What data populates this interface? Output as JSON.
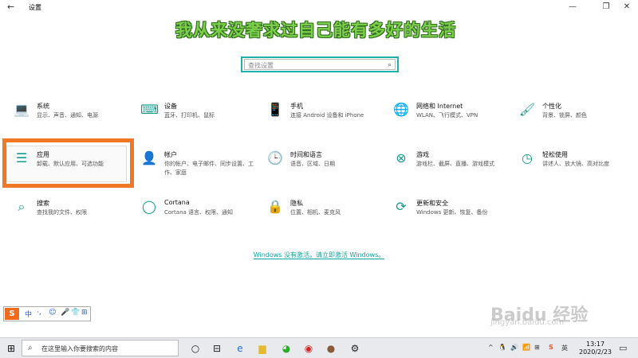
{
  "window": {
    "back_icon": "←",
    "title": "设置",
    "min_icon": "—",
    "max_icon": "❐",
    "close_icon": "✕"
  },
  "overlay_text": "我从来没奢求过自己能有多好的生活",
  "search": {
    "placeholder": "查找设置",
    "icon": "⌕"
  },
  "tiles": [
    {
      "key": "system",
      "icon": "💻",
      "name": "系统",
      "desc": "显示、声音、通知、电源"
    },
    {
      "key": "devices",
      "icon": "⌨",
      "name": "设备",
      "desc": "蓝牙、打印机、鼠标"
    },
    {
      "key": "phone",
      "icon": "📱",
      "name": "手机",
      "desc": "连接 Android 设备和 iPhone"
    },
    {
      "key": "network",
      "icon": "🌐",
      "name": "网络和 Internet",
      "desc": "WLAN、飞行模式、VPN"
    },
    {
      "key": "personalization",
      "icon": "🖌",
      "name": "个性化",
      "desc": "背景、锁屏、颜色"
    },
    {
      "key": "apps",
      "icon": "☰",
      "name": "应用",
      "desc": "卸载、默认应用、可选功能"
    },
    {
      "key": "accounts",
      "icon": "👤",
      "name": "帐户",
      "desc": "你的帐户、电子邮件、同步设置、工作、家庭"
    },
    {
      "key": "time-language",
      "icon": "🕒",
      "name": "时间和语言",
      "desc": "语音、区域、日期"
    },
    {
      "key": "gaming",
      "icon": "⊗",
      "name": "游戏",
      "desc": "游戏栏、截屏、直播、游戏模式"
    },
    {
      "key": "ease-of-access",
      "icon": "◷",
      "name": "轻松使用",
      "desc": "讲述人、放大镜、高对比度"
    },
    {
      "key": "search",
      "icon": "⌕",
      "name": "搜索",
      "desc": "查找我的文件、权限"
    },
    {
      "key": "cortana",
      "icon": "◯",
      "name": "Cortana",
      "desc": "Cortana 语言、权限、通知"
    },
    {
      "key": "privacy",
      "icon": "🔒",
      "name": "隐私",
      "desc": "位置、相机、麦克风"
    },
    {
      "key": "update-security",
      "icon": "⟳",
      "name": "更新和安全",
      "desc": "Windows 更新、恢复、备份"
    }
  ],
  "activation_link": "Windows 没有激活。请立即激活 Windows。",
  "ime": {
    "logo": "S",
    "items": [
      "中",
      "·,",
      "☺",
      "🎤",
      "👕",
      "⊞"
    ]
  },
  "watermark": {
    "line1": "Baidu 经验",
    "line2": "jingyan.baidu.com"
  },
  "taskbar": {
    "start_icon": "⊞",
    "search_icon": "⌕",
    "search_text": "在这里输入你要搜索的内容",
    "icons": [
      {
        "key": "task-view",
        "glyph": "○",
        "color": "#222"
      },
      {
        "key": "multitask",
        "glyph": "⊟",
        "color": "#222"
      },
      {
        "key": "edge",
        "glyph": "e",
        "color": "#1e6fd9"
      },
      {
        "key": "file-explorer",
        "glyph": "▆",
        "color": "#e8b830"
      },
      {
        "key": "wechat",
        "glyph": "◕",
        "color": "#2aae2a"
      },
      {
        "key": "netease-music",
        "glyph": "◉",
        "color": "#d22a2a"
      },
      {
        "key": "user-app",
        "glyph": "●",
        "color": "#8a5a3c"
      },
      {
        "key": "settings",
        "glyph": "⚙",
        "color": "#222"
      }
    ],
    "tray": [
      "^",
      "🐧",
      "🔊",
      "📶",
      "⊞",
      "S",
      "英"
    ],
    "time": "13:17",
    "date": "2020/2/23",
    "notification_icon": "▭"
  }
}
